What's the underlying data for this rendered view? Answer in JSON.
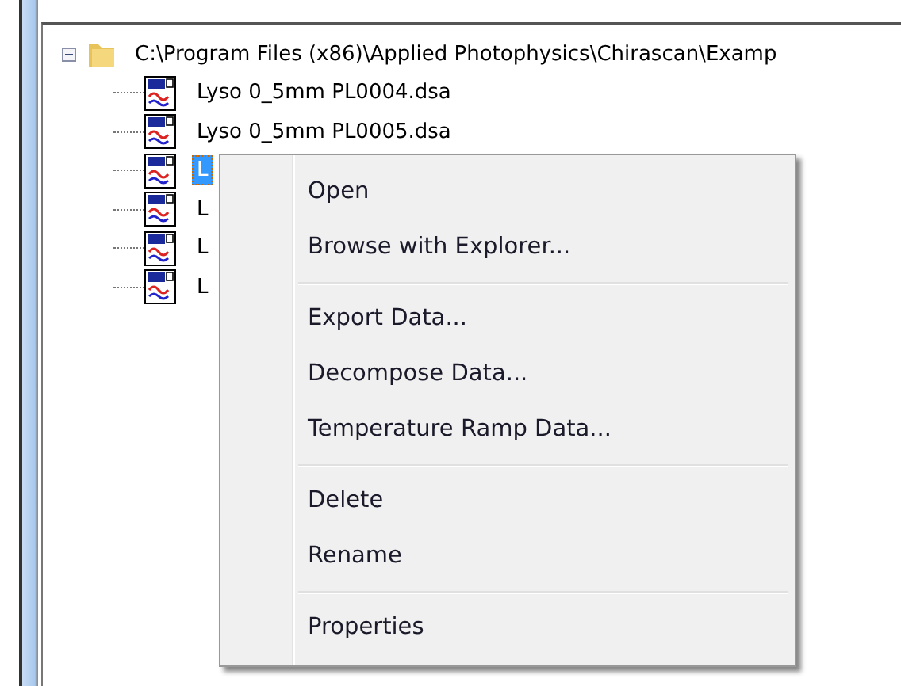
{
  "tree": {
    "label": "C:\\Program Files (x86)\\Applied Photophysics\\Chirascan\\Examp",
    "expanded": true,
    "children": [
      {
        "label": "Lyso 0_5mm PL0004.dsa",
        "selected": false
      },
      {
        "label": "Lyso 0_5mm PL0005.dsa",
        "selected": false
      },
      {
        "label": "L",
        "selected": true
      },
      {
        "label": "L",
        "selected": false
      },
      {
        "label": "L",
        "selected": false
      },
      {
        "label": "L",
        "selected": false
      }
    ]
  },
  "context_menu": {
    "groups": [
      [
        "Open",
        "Browse with Explorer..."
      ],
      [
        "Export Data...",
        "Decompose Data...",
        "Temperature Ramp Data..."
      ],
      [
        "Delete",
        "Rename"
      ],
      [
        "Properties"
      ]
    ]
  }
}
